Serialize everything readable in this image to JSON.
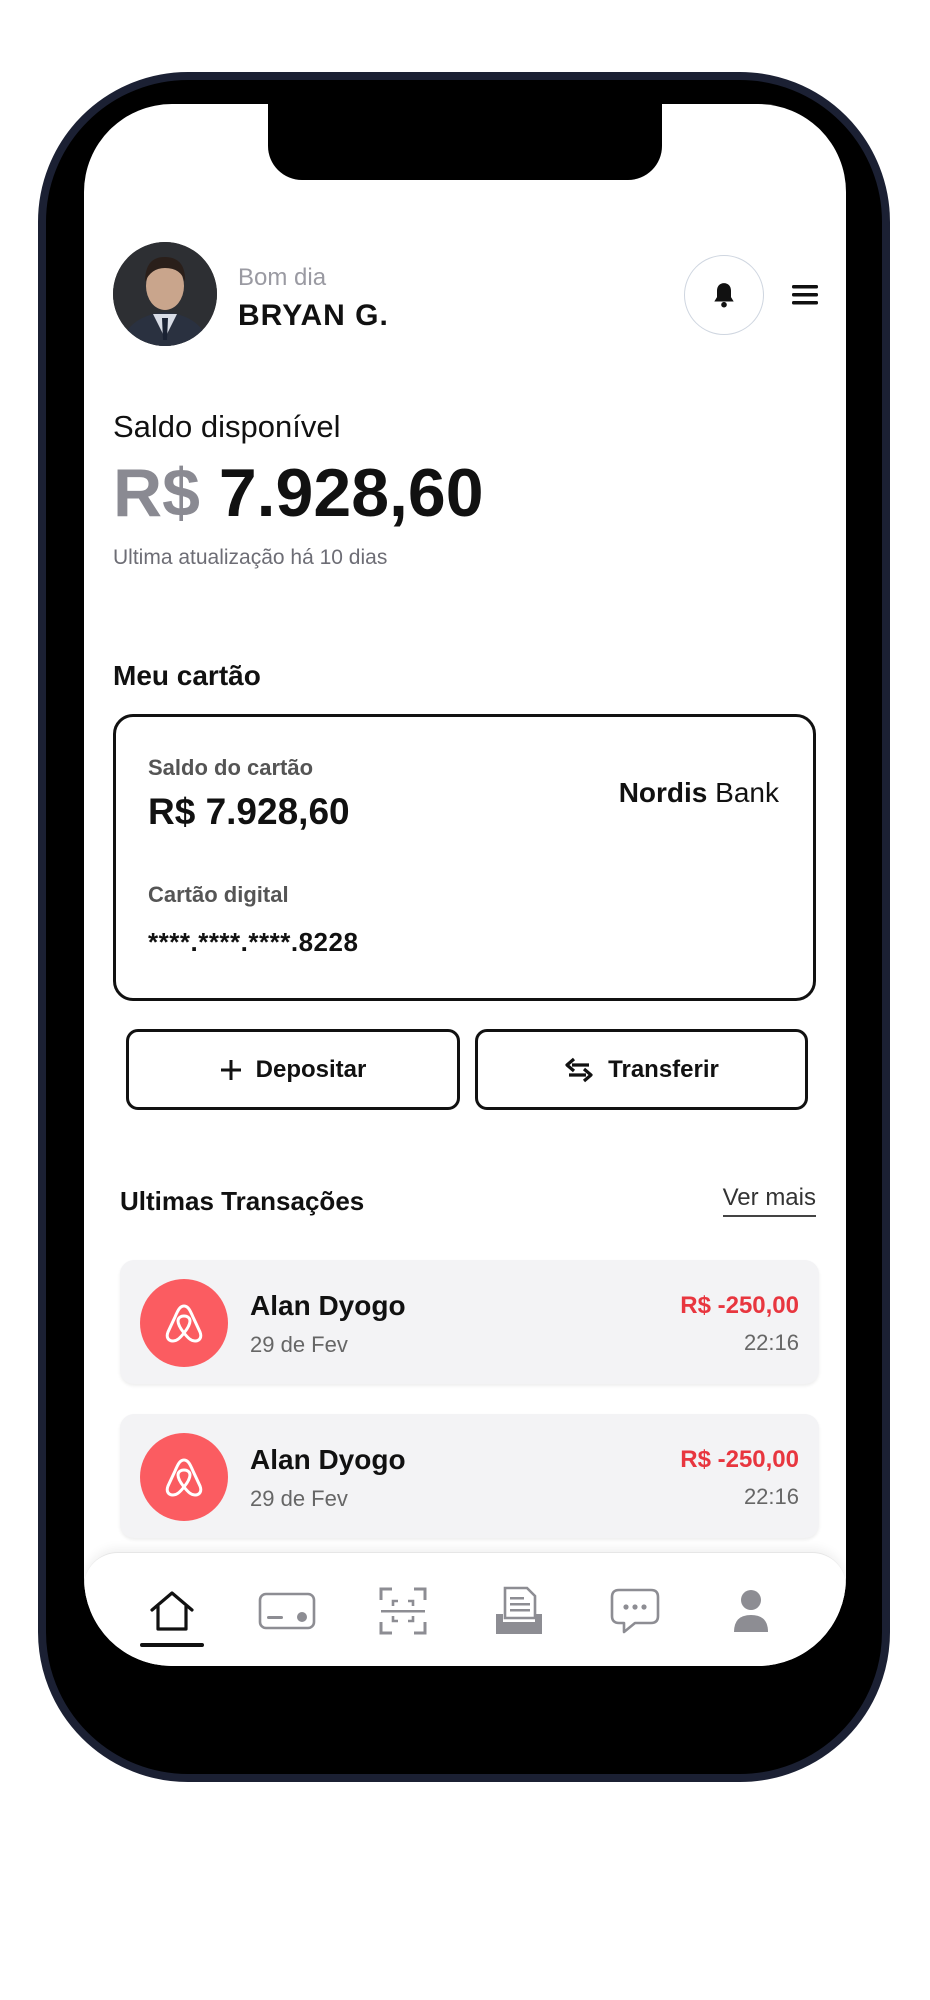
{
  "header": {
    "greeting": "Bom dia",
    "user_name": "BRYAN G."
  },
  "balance": {
    "label": "Saldo disponível",
    "currency": "R$",
    "amount": "7.928,60",
    "updated": "Ultima atualização há 10 dias"
  },
  "card": {
    "section_title": "Meu cartão",
    "balance_label": "Saldo do cartão",
    "balance": "R$ 7.928,60",
    "bank_name_bold": "Nordis",
    "bank_name_light": "Bank",
    "digital_label": "Cartão digital",
    "number": "****.****.****.8228"
  },
  "actions": {
    "deposit": "Depositar",
    "transfer": "Transferir"
  },
  "transactions": {
    "title": "Ultimas Transações",
    "see_more": "Ver mais",
    "items": [
      {
        "name": "Alan Dyogo",
        "date": "29 de Fev",
        "amount": "R$ -250,00",
        "time": "22:16",
        "icon": "airbnb-icon"
      },
      {
        "name": "Alan Dyogo",
        "date": "29 de Fev",
        "amount": "R$ -250,00",
        "time": "22:16",
        "icon": "airbnb-icon"
      }
    ]
  },
  "nav": {
    "items": [
      "home-icon",
      "card-icon",
      "scan-icon",
      "statement-icon",
      "chat-icon",
      "profile-icon"
    ],
    "active": "home-icon"
  },
  "colors": {
    "accent_red": "#fb5c61",
    "negative_amount": "#e8363f",
    "frame": "#1b2033"
  }
}
